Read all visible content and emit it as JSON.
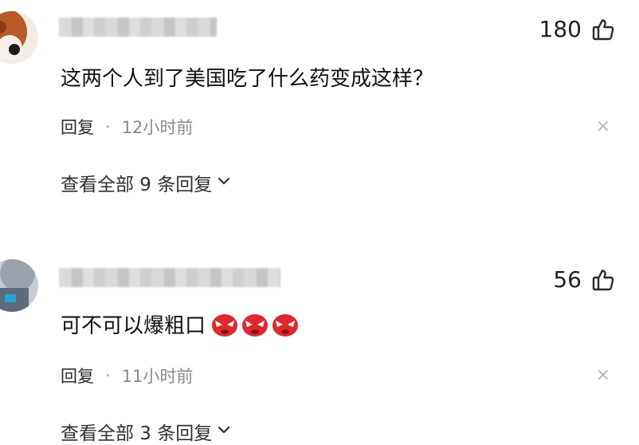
{
  "comments": [
    {
      "likes": "180",
      "text": "这两个人到了美国吃了什么药变成这样？",
      "emojis": [],
      "reply_label": "回复",
      "separator": "·",
      "time": "12小时前",
      "dismiss": "×",
      "view_replies": "查看全部 9 条回复"
    },
    {
      "likes": "56",
      "text": "可不可以爆粗口",
      "emojis": [
        "angry-face-emoji",
        "angry-face-emoji",
        "angry-face-emoji"
      ],
      "reply_label": "回复",
      "separator": "·",
      "time": "11小时前",
      "dismiss": "×",
      "view_replies": "查看全部 3 条回复"
    }
  ],
  "icons": {
    "like": "thumbs-up-icon",
    "dismiss": "close-icon",
    "expand": "chevron-down-icon"
  },
  "colors": {
    "text": "#111111",
    "meta": "#8a8a8a",
    "emoji": "#e0282f"
  }
}
